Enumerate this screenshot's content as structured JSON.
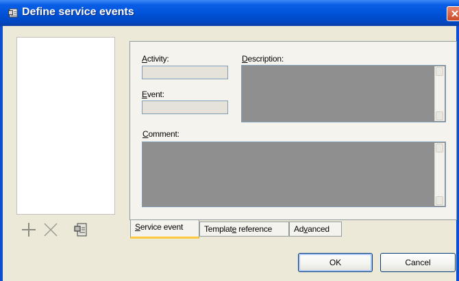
{
  "window": {
    "title": "Define service events",
    "titlebar_color": "#0052d6",
    "close_icon": "close-icon"
  },
  "list_toolbar": {
    "add_icon": "plus-icon",
    "delete_icon": "cross-icon",
    "properties_icon": "properties-icon"
  },
  "form": {
    "activity": {
      "label_prefix": "",
      "label_accel": "A",
      "label_rest": "ctivity:",
      "value": ""
    },
    "event": {
      "label_prefix": "",
      "label_accel": "E",
      "label_rest": "vent:",
      "value": ""
    },
    "description": {
      "label_prefix": "",
      "label_accel": "D",
      "label_rest": "escription:",
      "value": ""
    },
    "comment": {
      "label_prefix": "",
      "label_accel": "C",
      "label_rest": "omment:",
      "value": ""
    }
  },
  "tabs": [
    {
      "prefix": "",
      "accel": "S",
      "rest": "ervice event"
    },
    {
      "prefix": "Templat",
      "accel": "e",
      "rest": " reference"
    },
    {
      "prefix": "Ad",
      "accel": "v",
      "rest": "anced"
    }
  ],
  "buttons": {
    "ok": "OK",
    "cancel": "Cancel"
  }
}
